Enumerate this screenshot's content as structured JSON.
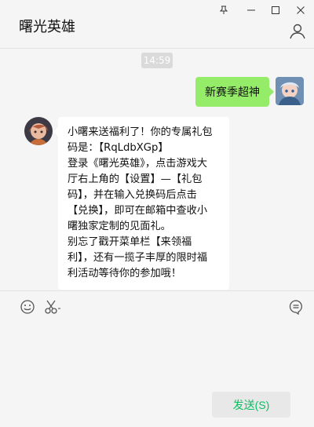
{
  "window": {
    "title": "曙光英雄",
    "controls": [
      "pin-icon",
      "minimize-icon",
      "maximize-icon",
      "close-icon"
    ]
  },
  "chat": {
    "time": "14:59",
    "outgoing": {
      "text": "新赛季超神"
    },
    "incoming": {
      "lines": [
        "小曙来送福利了！你的专属礼包",
        "码是：【RqLdbXGp】",
        "登录《曙光英雄》，点击游戏大",
        "厅右上角的【设置】—【礼包",
        "码】，并在输入兑换码后点击",
        "【兑换】，即可在邮箱中查收小",
        "曙独家定制的见面礼。",
        "别忘了戳开菜单栏【来领福",
        "利】，还有一揽子丰厚的限时福",
        "利活动等待你的参加哦！"
      ]
    }
  },
  "toolbar": {
    "emoji_icon": "emoji-icon",
    "scissors_icon": "scissors-icon",
    "chat_icon": "chat-bubble-icon"
  },
  "send": {
    "label": "发送(S)"
  },
  "colors": {
    "bubble_out": "#95ec69",
    "send_text": "#07c160",
    "bg": "#f5f5f5"
  }
}
